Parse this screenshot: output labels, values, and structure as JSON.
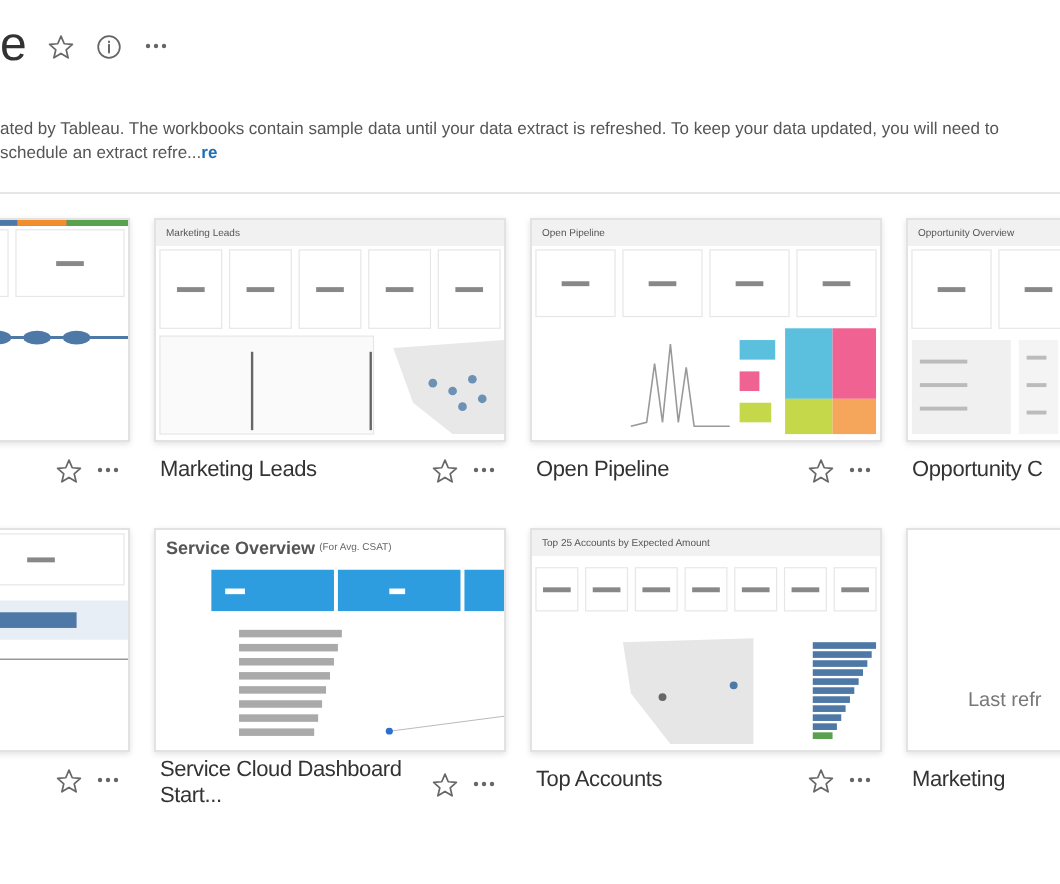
{
  "header": {
    "title": "e",
    "favorite": false
  },
  "description": {
    "text": "ated by Tableau. The workbooks contain sample data until your data extract is refreshed. To keep your data updated, you will need to schedule an extract refre...",
    "link": "re"
  },
  "workbooks": [
    {
      "favorite": false,
      "thumbnail": {
        "kind": "bubbles"
      }
    },
    {
      "title": "Marketing Leads",
      "favorite": false,
      "thumbnail": {
        "kind": "map",
        "title": "Marketing Leads"
      }
    },
    {
      "title": "Open Pipeline",
      "favorite": false,
      "thumbnail": {
        "kind": "pipeline",
        "title": "Open Pipeline"
      }
    },
    {
      "title": "Opportunity C",
      "thumbnail": {
        "kind": "kpis",
        "title": "Opportunity Overview"
      }
    },
    {
      "favorite": false,
      "thumbnail": {
        "kind": "steps"
      }
    },
    {
      "title": "Service Cloud Dashboard Start...",
      "favorite": false,
      "thumbnail": {
        "kind": "service",
        "title": "Service Overview",
        "subtitle": "(For Avg. CSAT)"
      }
    },
    {
      "title": "Top Accounts",
      "favorite": false,
      "thumbnail": {
        "kind": "accounts",
        "title": "Top 25 Accounts by Expected Amount"
      }
    },
    {
      "title": "Marketing",
      "thumbnail": {
        "kind": "empty",
        "note": "Last refr"
      }
    }
  ]
}
